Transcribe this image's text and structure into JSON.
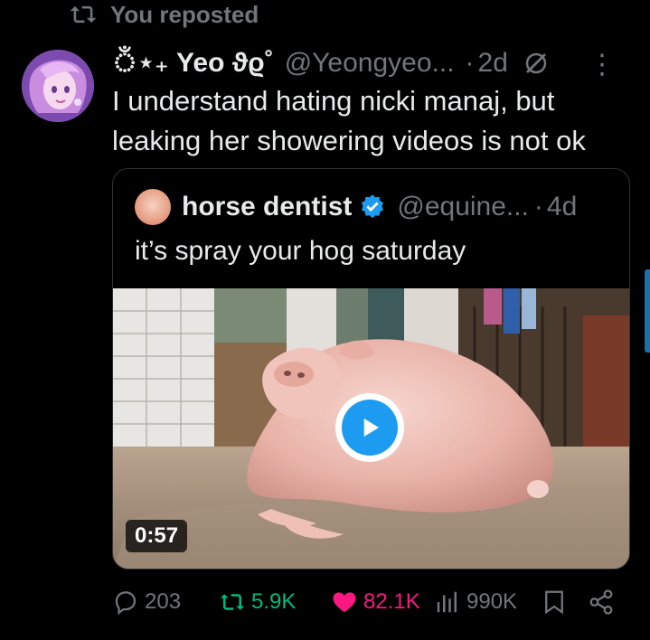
{
  "repost_banner": {
    "text": "You reposted",
    "icon": "repost-icon"
  },
  "tweet": {
    "author_name": "ঁ⋆₊ Yeo ϑϱ˚",
    "handle": "@Yeongyeo...",
    "separator": "·",
    "time": "2d",
    "text": "I understand hating nicki manaj, but leaking her showering videos is not ok"
  },
  "quote": {
    "author_name": "horse dentist",
    "handle": "@equine...",
    "separator": "·",
    "time": "4d",
    "text": "it’s spray your hog saturday",
    "video_duration": "0:57"
  },
  "actions": {
    "replies": "203",
    "reposts": "5.9K",
    "likes": "82.1K",
    "views": "990K"
  },
  "colors": {
    "background": "#000000",
    "text": "#e7e9ea",
    "muted": "#71767b",
    "repost_green": "#00ba7c",
    "like_pink": "#f91880",
    "accent_blue": "#1d9bf0"
  }
}
